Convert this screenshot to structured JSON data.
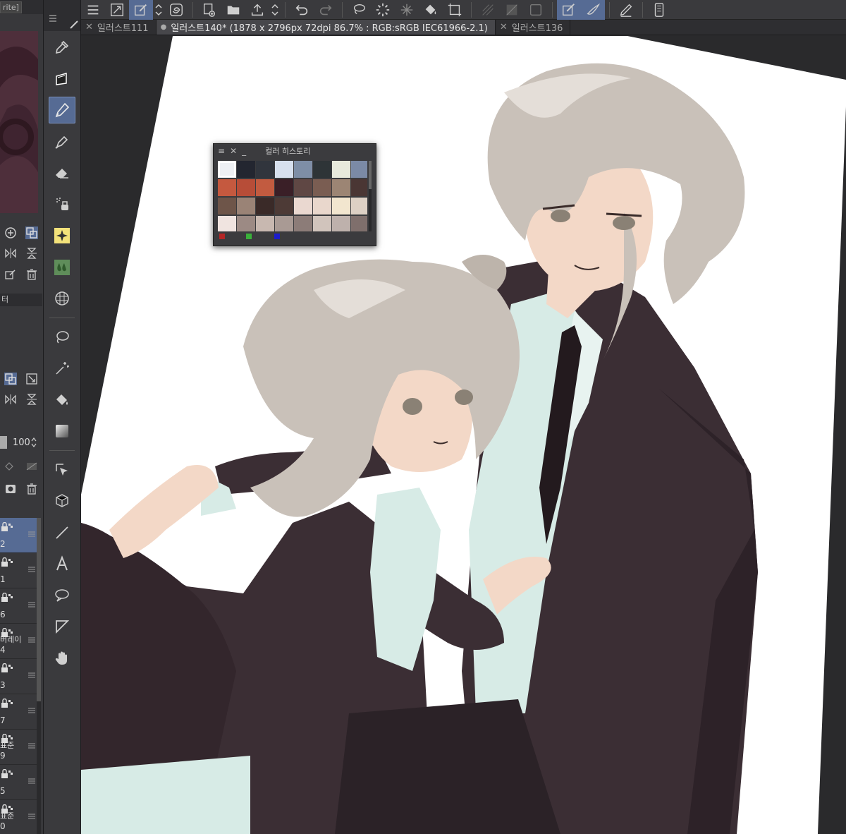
{
  "app": {
    "left_panel_header": "rite]",
    "layer_section_label": "터",
    "opacity_value": "100"
  },
  "tabs": [
    {
      "label": "일러스트111",
      "active": false,
      "modified": false
    },
    {
      "label": "일러스트140* (1878 x 2796px 72dpi 86.7% : RGB:sRGB IEC61966-2.1)",
      "active": true,
      "modified": true
    },
    {
      "label": "일러스트136",
      "active": false,
      "modified": false
    }
  ],
  "layers": [
    {
      "name": "",
      "num": "2",
      "selected": true
    },
    {
      "name": "",
      "num": "1",
      "selected": false
    },
    {
      "name": "",
      "num": "6",
      "selected": false
    },
    {
      "name": "버레이",
      "num": "4",
      "selected": false
    },
    {
      "name": "",
      "num": "3",
      "selected": false
    },
    {
      "name": "",
      "num": "7",
      "selected": false
    },
    {
      "name": "표준",
      "num": "9",
      "selected": false
    },
    {
      "name": "",
      "num": "5",
      "selected": false
    },
    {
      "name": "표준",
      "num": "0",
      "selected": false
    }
  ],
  "tools": [
    {
      "icon": "eyedropper-icon",
      "active": false
    },
    {
      "icon": "fill-brush-icon",
      "active": false
    },
    {
      "icon": "pen-icon",
      "active": true
    },
    {
      "icon": "pencil-icon",
      "active": false
    },
    {
      "icon": "eraser-icon",
      "active": false
    },
    {
      "icon": "airbrush-icon",
      "active": false
    },
    {
      "icon": "sparkle-decoration-icon",
      "active": false
    },
    {
      "icon": "blend-drops-icon",
      "active": false
    },
    {
      "icon": "grid-figure-icon",
      "active": false
    },
    {
      "icon": "lasso-icon",
      "active": false
    },
    {
      "icon": "auto-select-wand-icon",
      "active": false
    },
    {
      "icon": "fill-bucket-icon",
      "active": false
    },
    {
      "icon": "gradient-icon",
      "active": false
    },
    {
      "icon": "object-select-icon",
      "active": false
    },
    {
      "icon": "3d-operation-icon",
      "active": false
    },
    {
      "icon": "line-figure-icon",
      "active": false
    },
    {
      "icon": "text-tool-icon",
      "active": false
    },
    {
      "icon": "balloon-icon",
      "active": false
    },
    {
      "icon": "frame-border-icon",
      "active": false
    },
    {
      "icon": "hand-icon",
      "active": false
    }
  ],
  "toolbar_icons": [
    "menu-icon",
    "transform-icon",
    "edit-icon",
    "vertical-arrows-icon",
    "clip-studio-icon",
    "new-layer-icon",
    "open-folder-icon",
    "export-icon",
    "vertical-arrows-icon",
    "undo-icon",
    "redo-icon",
    "lasso-select-icon",
    "loading-icon",
    "sparkle-icon",
    "fill-icon",
    "crop-icon",
    "hatch-icon",
    "gradient-box-icon",
    "frame-icon",
    "draw-mode-icon",
    "brush-mode-icon",
    "stylus-icon",
    "tablet-icon"
  ],
  "color_history": {
    "title": "컬러 히스토리",
    "swatches": [
      "#eef0f4",
      "#232630",
      "#31353d",
      "#d7e0ee",
      "#7e8ea6",
      "#2e3437",
      "#e7e9dc",
      "#7b8aa6",
      "#c5593f",
      "#b74d38",
      "#c25b40",
      "#3a1f27",
      "#5f4744",
      "#7a5d52",
      "#9c8574",
      "#4a3634",
      "#6e5549",
      "#9a8376",
      "#3a2a28",
      "#4d3a36",
      "#ead8d0",
      "#e9d7cc",
      "#f2e6cf",
      "#ddd0c4",
      "#f0e4e0",
      "#9c8a84",
      "#c8b8b0",
      "#a99a94",
      "#8c7c78",
      "#d1c4bc",
      "#beb1ac",
      "#7f6f6c"
    ],
    "footer_colors": [
      "#b32626",
      "#3ab03a",
      "#1c1ccc"
    ]
  },
  "colors": {
    "accent": "#566b94",
    "panel": "#38383b",
    "coat": "#3b2e34",
    "shirt": "#d7ebe6",
    "hair": "#c9c1b9",
    "skin": "#f3d8c7"
  }
}
